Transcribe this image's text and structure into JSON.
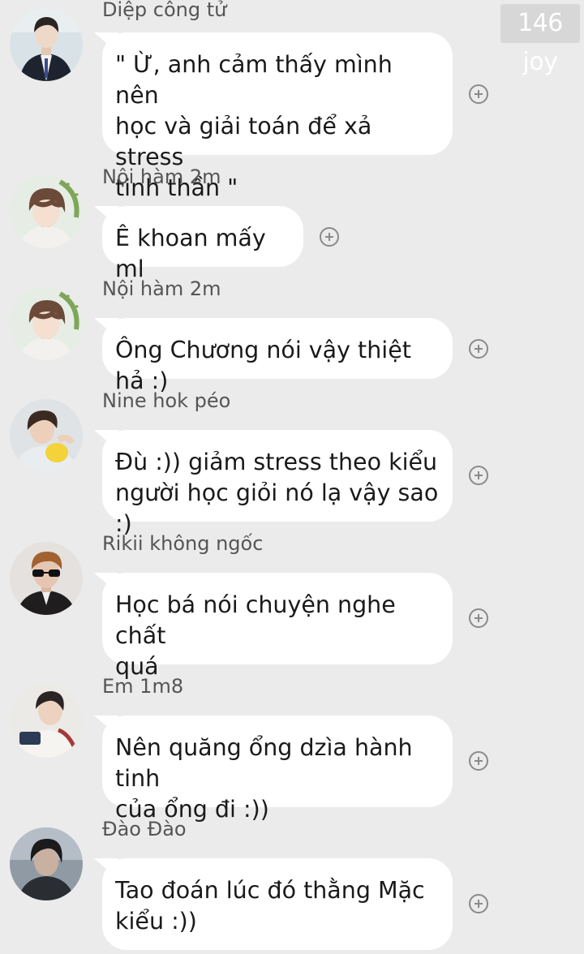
{
  "watermark": "146 joy",
  "messages": [
    {
      "sender": "Diệp công tử",
      "text": " \" Ừ, anh cảm thấy mình nên\nhọc và giải toán để xả stress\ntinh thần \""
    },
    {
      "sender": "Nội hàm 2m",
      "text": "Ê khoan mấy ml"
    },
    {
      "sender": "Nội hàm 2m",
      "text": "Ông Chương nói vậy thiệt hả :)"
    },
    {
      "sender": "Nine hok péo",
      "text": "Đù :)) giảm stress theo kiểu\nngười học giỏi nó lạ vậy sao :)"
    },
    {
      "sender": "Rikii không ngốc",
      "text": "Học bá nói chuyện nghe chất\nquá"
    },
    {
      "sender": "Em 1m8",
      "text": "Nên quăng ổng dzìa hành tinh\ncủa ổng đi :))"
    },
    {
      "sender": "Đào Đào",
      "text": "Tao đoán lúc đó thằng Mặc\nkiểu :))"
    }
  ],
  "colors": {
    "background": "#ebebeb",
    "bubble": "#ffffff",
    "sender_name": "#555555",
    "text": "#1a1a1a",
    "react_icon": "#8a8a8a"
  },
  "icons": {
    "react": "add-reaction-icon"
  }
}
